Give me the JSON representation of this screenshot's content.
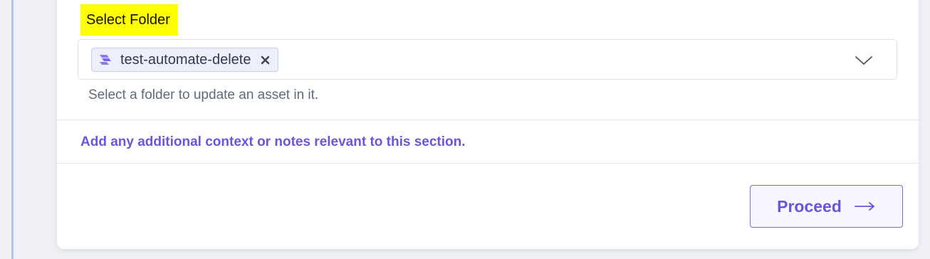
{
  "field": {
    "label": "Select Folder",
    "selected_chip": {
      "label": "test-automate-delete",
      "icon": "folder-stack-icon"
    },
    "helper_text": "Select a folder to update an asset in it."
  },
  "notes": {
    "link_text": "Add any additional context or notes relevant to this section."
  },
  "actions": {
    "proceed_label": "Proceed",
    "proceed_icon": "arrow-right-icon"
  },
  "colors": {
    "accent": "#6c55dd",
    "highlight": "#ffff00",
    "chip_bg": "#edf0fc",
    "page_bg": "#eef0f5"
  }
}
